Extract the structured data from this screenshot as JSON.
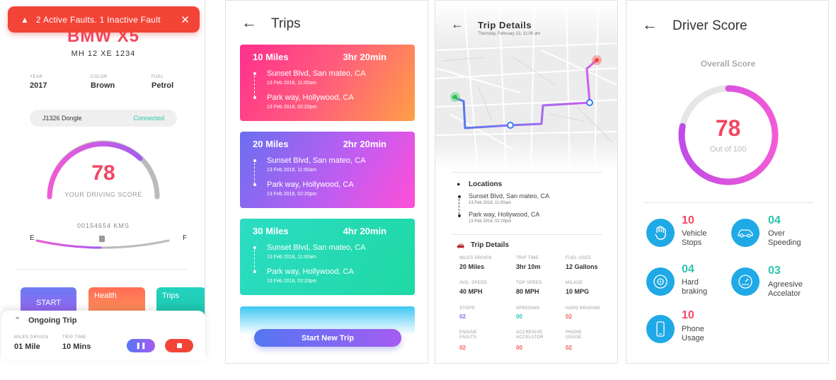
{
  "vehicle": {
    "fault_banner": "2 Active Faults. 1 Inactive Fault",
    "model": "BMW X5",
    "plate": "MH 12 XE 1234",
    "specs": [
      {
        "label": "YEAR",
        "value": "2017"
      },
      {
        "label": "COLOR",
        "value": "Brown"
      },
      {
        "label": "FUEL",
        "value": "Petrol"
      }
    ],
    "dongle_id": "J1326 Dongle",
    "dongle_status": "Connected",
    "score": "78",
    "score_label": "YOUR DRIVING SCORE",
    "odometer": "00154654 KMS",
    "fuel_empty": "E",
    "fuel_full": "F",
    "tiles": [
      "START",
      "Health",
      "Trips"
    ],
    "ongoing": {
      "title": "Ongoing Trip",
      "miles_label": "MILES DRIVEN",
      "miles_value": "01 Mile",
      "time_label": "TRIP TIME",
      "time_value": "10 Mins"
    }
  },
  "trips": {
    "title": "Trips",
    "cards": [
      {
        "miles": "10 Miles",
        "duration": "3hr 20min",
        "from": "Sunset Blvd, San mateo, CA",
        "from_time": "13 Feb 2018, 11:00am",
        "to": "Park way, Hollywood, CA",
        "to_time": "13 Feb 2018, 02:20pm"
      },
      {
        "miles": "20 Miles",
        "duration": "2hr 20min",
        "from": "Sunset Blvd, San mateo, CA",
        "from_time": "13 Feb 2018, 11:00am",
        "to": "Park way, Hollywood, CA",
        "to_time": "13 Feb 2018, 02:20pm"
      },
      {
        "miles": "30 Miles",
        "duration": "4hr 20min",
        "from": "Sunset Blvd, San mateo, CA",
        "from_time": "13 Feb 2018, 11:00am",
        "to": "Park way, Hollywood, CA",
        "to_time": "13 Feb 2018, 02:20pm"
      }
    ],
    "start_button": "Start New Trip"
  },
  "trip_details": {
    "title": "Trip Details",
    "subtitle": "Thursday, February 13, 11:00 am",
    "locations_title": "Locations",
    "from": "Sunset Blvd, San mateo, CA",
    "from_time": "13 Feb 2018, 11:00am",
    "to": "Park way, Hollywood, CA",
    "to_time": "13 Feb 2018, 02:20pm",
    "details_title": "Trip Details",
    "stats": [
      {
        "label": "MILES DRIVEN",
        "value": "20 Miles"
      },
      {
        "label": "TRIP TIME",
        "value": "3hr 10m"
      },
      {
        "label": "FUEL USED",
        "value": "12 Gallons"
      },
      {
        "label": "AVG. SPEED",
        "value": "40 MPH"
      },
      {
        "label": "TOP SPEED",
        "value": "80 MPH"
      },
      {
        "label": "MILAGE",
        "value": "10 MPG"
      }
    ],
    "counts": [
      {
        "label": "STOPS",
        "value": "02",
        "color": "#7b6cf0"
      },
      {
        "label": "SPEEDING",
        "value": "00",
        "color": "#2bc4b0"
      },
      {
        "label": "HARD BRAKING",
        "value": "02",
        "color": "#f45c5c"
      },
      {
        "label": "ENGINE FAULTS",
        "value": "02",
        "color": "#f45c5c"
      },
      {
        "label": "ACCRESIVE ACCELATOR",
        "value": "00",
        "color": "#f45c5c"
      },
      {
        "label": "PHONE USAGE",
        "value": "02",
        "color": "#f45c5c"
      }
    ]
  },
  "driver_score": {
    "title": "Driver Score",
    "overall_label": "Overall Score",
    "score": "78",
    "out_of": "Out of 100",
    "score_fraction": 0.78,
    "metrics": [
      {
        "value": "10",
        "label": "Vehicle Stops",
        "color": "#f44561",
        "icon": "hand-stop-icon"
      },
      {
        "value": "04",
        "label": "Over Speeding",
        "color": "#2bc4b0",
        "icon": "car-speed-icon"
      },
      {
        "value": "04",
        "label": "Hard braking",
        "color": "#2bc4b0",
        "icon": "brake-icon"
      },
      {
        "value": "03",
        "label": "Agreesive Accelator",
        "color": "#2bc4b0",
        "icon": "speedometer-icon"
      },
      {
        "value": "10",
        "label": "Phone Usage",
        "color": "#f44561",
        "icon": "phone-icon"
      }
    ]
  }
}
